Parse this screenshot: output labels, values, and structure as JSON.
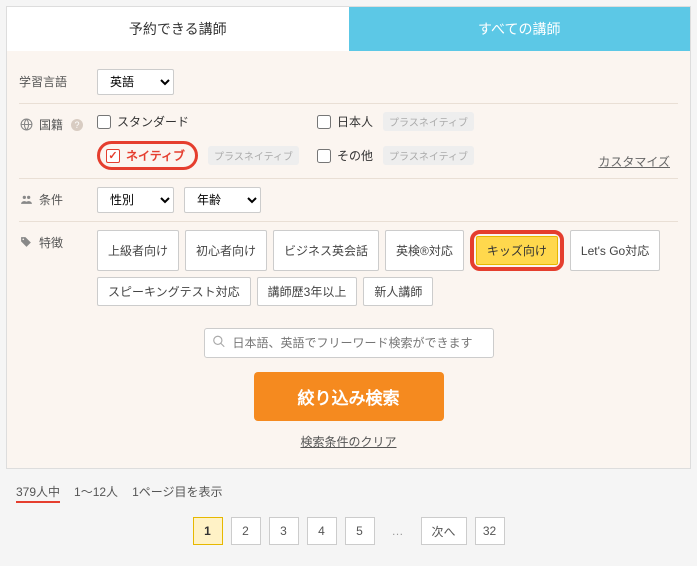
{
  "tabs": {
    "bookable": "予約できる講師",
    "all": "すべての講師"
  },
  "language": {
    "label": "学習言語",
    "selected": "英語"
  },
  "nationality": {
    "label": "国籍",
    "standard": "スタンダード",
    "native": "ネイティブ",
    "plus_native": "プラスネイティブ",
    "japanese": "日本人",
    "other": "その他",
    "customize": "カスタマイズ"
  },
  "conditions": {
    "label": "条件",
    "gender": "性別",
    "age": "年齢"
  },
  "features": {
    "label": "特徴",
    "tags": [
      "上級者向け",
      "初心者向け",
      "ビジネス英会話",
      "英検®対応",
      "キッズ向け",
      "Let's Go対応",
      "スピーキングテスト対応",
      "講師歴3年以上",
      "新人講師"
    ]
  },
  "search": {
    "placeholder": "日本語、英語でフリーワード検索ができます",
    "submit": "絞り込み検索",
    "clear": "検索条件のクリア"
  },
  "results": {
    "total": "379人中",
    "range": "1～12人",
    "page_info": "1ページ目を表示"
  },
  "pager": {
    "p1": "1",
    "p2": "2",
    "p3": "3",
    "p4": "4",
    "p5": "5",
    "dots": "…",
    "next": "次へ",
    "last": "32"
  }
}
